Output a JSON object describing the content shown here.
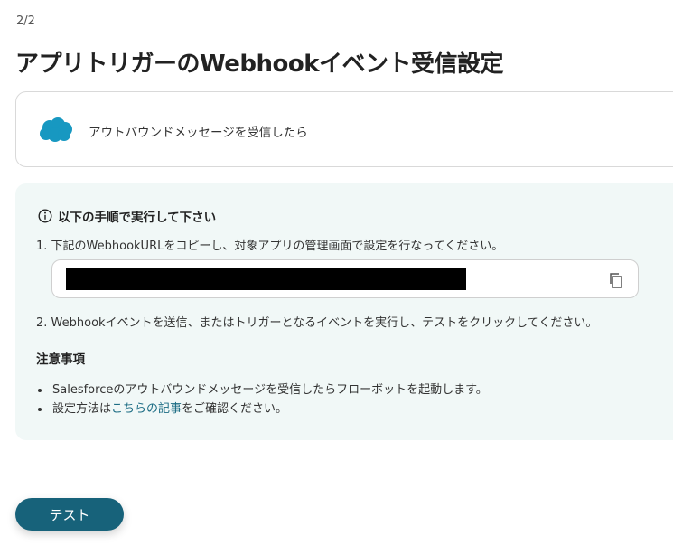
{
  "header": {
    "step": "2/2",
    "title": "アプリトリガーのWebhookイベント受信設定"
  },
  "app_card": {
    "icon": "salesforce-cloud-icon",
    "trigger_label": "アウトバウンドメッセージを受信したら",
    "brand_color": "#1798c1"
  },
  "instructions": {
    "heading": "以下の手順で実行して下さい",
    "step1": "1. 下記のWebhookURLをコピーし、対象アプリの管理画面で設定を行なってください。",
    "url_value": "",
    "copy_icon": "copy-icon",
    "step2": "2. Webhookイベントを送信、またはトリガーとなるイベントを実行し、テストをクリックしてください。"
  },
  "notes": {
    "heading": "注意事項",
    "item1": "Salesforceのアウトバウンドメッセージを受信したらフローボットを起動します。",
    "item2_prefix": "設定方法は",
    "item2_link": "こちらの記事",
    "item2_suffix": "をご確認ください。"
  },
  "actions": {
    "test_label": "テスト",
    "accent_color": "#17627a"
  }
}
